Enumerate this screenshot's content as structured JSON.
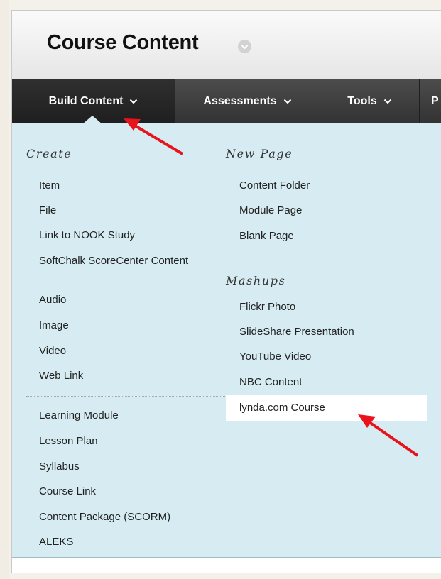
{
  "page": {
    "title": "Course Content"
  },
  "nav": {
    "tabs": [
      {
        "label": "Build Content",
        "active": true
      },
      {
        "label": "Assessments",
        "active": false
      },
      {
        "label": "Tools",
        "active": false
      },
      {
        "label": "P",
        "active": false
      }
    ]
  },
  "menu": {
    "create": {
      "heading": "Create",
      "group1": [
        "Item",
        "File",
        "Link to NOOK Study",
        "SoftChalk ScoreCenter Content"
      ],
      "group2": [
        "Audio",
        "Image",
        "Video",
        "Web Link"
      ],
      "group3": [
        "Learning Module",
        "Lesson Plan",
        "Syllabus",
        "Course Link",
        "Content Package (SCORM)",
        "ALEKS"
      ]
    },
    "new_page": {
      "heading": "New Page",
      "items": [
        "Content Folder",
        "Module Page",
        "Blank Page"
      ]
    },
    "mashups": {
      "heading": "Mashups",
      "items": [
        "Flickr Photo",
        "SlideShare Presentation",
        "YouTube Video",
        "NBC Content",
        "lynda.com Course"
      ]
    }
  },
  "colors": {
    "menu_bg": "#d6ecf2",
    "nav_bg": "#3a3a3a",
    "arrow": "#e8131b",
    "highlight": "#ffffff"
  },
  "icons": [
    "chevron-down-icon",
    "options-chevron-icon",
    "red-arrow-annotation"
  ]
}
